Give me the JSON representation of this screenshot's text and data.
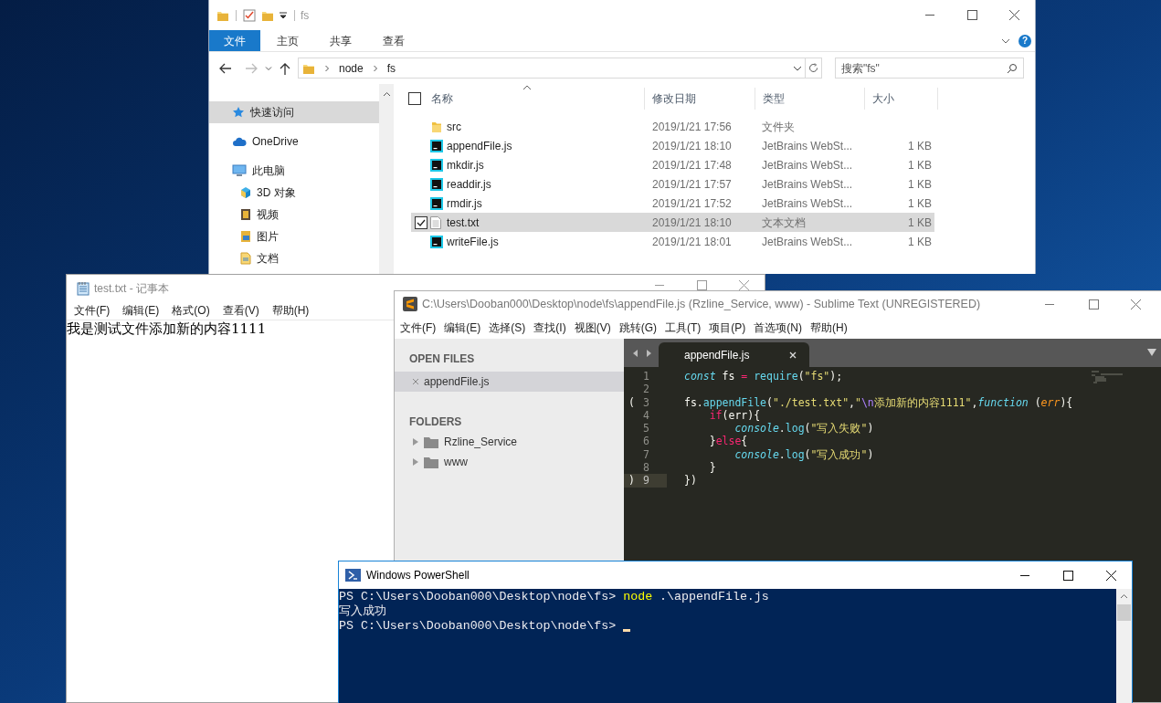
{
  "explorer": {
    "title": "fs",
    "ribbon_tabs": [
      {
        "label": "文件",
        "selected": true
      },
      {
        "label": "主页",
        "selected": false
      },
      {
        "label": "共享",
        "selected": false
      },
      {
        "label": "查看",
        "selected": false
      }
    ],
    "help": "?",
    "address": [
      "node",
      "fs"
    ],
    "search": {
      "placeholder": "搜索\"fs\""
    },
    "nav": [
      {
        "label": "快速访问",
        "kind": "star",
        "selected": true
      },
      {
        "label": "OneDrive",
        "kind": "cloud",
        "selected": false
      },
      {
        "label": "此电脑",
        "kind": "computer",
        "selected": false,
        "children": [
          {
            "label": "3D 对象",
            "kind": "cube",
            "selected": false
          },
          {
            "label": "视频",
            "kind": "video",
            "selected": false
          },
          {
            "label": "图片",
            "kind": "image",
            "selected": false
          },
          {
            "label": "文档",
            "kind": "document",
            "selected": false
          }
        ]
      }
    ],
    "select_all": {
      "checked": false
    },
    "columns": [
      "名称",
      "修改日期",
      "类型",
      "大小"
    ],
    "rows": [
      {
        "name": "src",
        "kind": "folder",
        "date": "2019/1/21 17:56",
        "type": "文件夹",
        "selected": false,
        "checked": false
      },
      {
        "name": "appendFile.js",
        "kind": "js",
        "date": "2019/1/21 18:10",
        "type": "JetBrains WebSt...",
        "size": "1 KB",
        "selected": false,
        "checked": false
      },
      {
        "name": "mkdir.js",
        "kind": "js",
        "date": "2019/1/21 17:48",
        "type": "JetBrains WebSt...",
        "size": "1 KB",
        "selected": false,
        "checked": false
      },
      {
        "name": "readdir.js",
        "kind": "js",
        "date": "2019/1/21 17:57",
        "type": "JetBrains WebSt...",
        "size": "1 KB",
        "selected": false,
        "checked": false
      },
      {
        "name": "rmdir.js",
        "kind": "js",
        "date": "2019/1/21 17:52",
        "type": "JetBrains WebSt...",
        "size": "1 KB",
        "selected": false,
        "checked": false
      },
      {
        "name": "test.txt",
        "kind": "txt",
        "date": "2019/1/21 18:10",
        "type": "文本文档",
        "size": "1 KB",
        "selected": true,
        "checked": true
      },
      {
        "name": "writeFile.js",
        "kind": "js",
        "date": "2019/1/21 18:01",
        "type": "JetBrains WebSt...",
        "size": "1 KB",
        "selected": false,
        "checked": false
      }
    ]
  },
  "notepad": {
    "title": "test.txt - 记事本",
    "menu": [
      "文件(F)",
      "编辑(E)",
      "格式(O)",
      "查看(V)",
      "帮助(H)"
    ],
    "text": "我是测试文件添加新的内容1111"
  },
  "sublime": {
    "title": "C:\\Users\\Dooban000\\Desktop\\node\\fs\\appendFile.js (Rzline_Service, www) - Sublime Text (UNREGISTERED)",
    "menu": [
      "文件(F)",
      "编辑(E)",
      "选择(S)",
      "查找(I)",
      "视图(V)",
      "跳转(G)",
      "工具(T)",
      "项目(P)",
      "首选项(N)",
      "帮助(H)"
    ],
    "open_files_header": "OPEN FILES",
    "open_files": [
      {
        "label": "appendFile.js",
        "selected": true
      }
    ],
    "folders_header": "FOLDERS",
    "folders": [
      "Rzline_Service",
      "www"
    ],
    "tab": "appendFile.js",
    "code": [
      {
        "number": "1",
        "current": false,
        "tokens": [
          {
            "text": "const",
            "kind": "storage"
          },
          {
            "text": " fs ",
            "kind": "plain"
          },
          {
            "text": "=",
            "kind": "keyword"
          },
          {
            "text": " require",
            "kind": "support"
          },
          {
            "text": "(",
            "kind": "plain"
          },
          {
            "text": "\"fs\"",
            "kind": "string"
          },
          {
            "text": ");",
            "kind": "plain"
          }
        ]
      },
      {
        "number": "2",
        "current": false
      },
      {
        "number": "3",
        "gutter": "(",
        "current": false,
        "tokens": [
          {
            "text": "fs.",
            "kind": "plain"
          },
          {
            "text": "appendFile",
            "kind": "support"
          },
          {
            "text": "(",
            "kind": "plain"
          },
          {
            "text": "\"./test.txt\"",
            "kind": "string"
          },
          {
            "text": ",",
            "kind": "plain"
          },
          {
            "text": "\"",
            "kind": "string"
          },
          {
            "text": "\\n",
            "kind": "escape"
          },
          {
            "text": "添加新的内容1111\"",
            "kind": "string"
          },
          {
            "text": ",",
            "kind": "plain"
          },
          {
            "text": "function",
            "kind": "storage"
          },
          {
            "text": " (",
            "kind": "plain"
          },
          {
            "text": "err",
            "kind": "param"
          },
          {
            "text": "){",
            "kind": "plain"
          }
        ]
      },
      {
        "number": "4",
        "current": false,
        "tokens": [
          {
            "text": "    if",
            "kind": "keyword"
          },
          {
            "text": "(err){",
            "kind": "plain"
          }
        ]
      },
      {
        "number": "5",
        "current": false,
        "tokens": [
          {
            "text": "        console",
            "kind": "storage"
          },
          {
            "text": ".",
            "kind": "plain"
          },
          {
            "text": "log",
            "kind": "support"
          },
          {
            "text": "(",
            "kind": "plain"
          },
          {
            "text": "\"写入失败\"",
            "kind": "string"
          },
          {
            "text": ")",
            "kind": "plain"
          }
        ]
      },
      {
        "number": "6",
        "current": false,
        "tokens": [
          {
            "text": "    }",
            "kind": "plain"
          },
          {
            "text": "else",
            "kind": "keyword"
          },
          {
            "text": "{",
            "kind": "plain"
          }
        ]
      },
      {
        "number": "7",
        "current": false,
        "tokens": [
          {
            "text": "        console",
            "kind": "storage"
          },
          {
            "text": ".",
            "kind": "plain"
          },
          {
            "text": "log",
            "kind": "support"
          },
          {
            "text": "(",
            "kind": "plain"
          },
          {
            "text": "\"写入成功\"",
            "kind": "string"
          },
          {
            "text": ")",
            "kind": "plain"
          }
        ]
      },
      {
        "number": "8",
        "current": false,
        "tokens": [
          {
            "text": "    }",
            "kind": "plain"
          }
        ]
      },
      {
        "number": "9",
        "gutter": ")",
        "current": true,
        "tokens": [
          {
            "text": "})",
            "kind": "plain"
          }
        ]
      }
    ]
  },
  "powershell": {
    "title": "Windows PowerShell",
    "cursor": true,
    "lines": [
      [
        {
          "text": "PS C:\\Users\\Dooban000\\Desktop\\node\\fs> ",
          "kind": "plain"
        },
        {
          "text": "node",
          "kind": "command"
        },
        {
          "text": " .\\appendFile.js",
          "kind": "plain"
        }
      ],
      [
        {
          "text": "写入成功",
          "kind": "plain"
        }
      ],
      [
        {
          "text": "PS C:\\Users\\Dooban000\\Desktop\\node\\fs> ",
          "kind": "plain"
        }
      ]
    ]
  }
}
